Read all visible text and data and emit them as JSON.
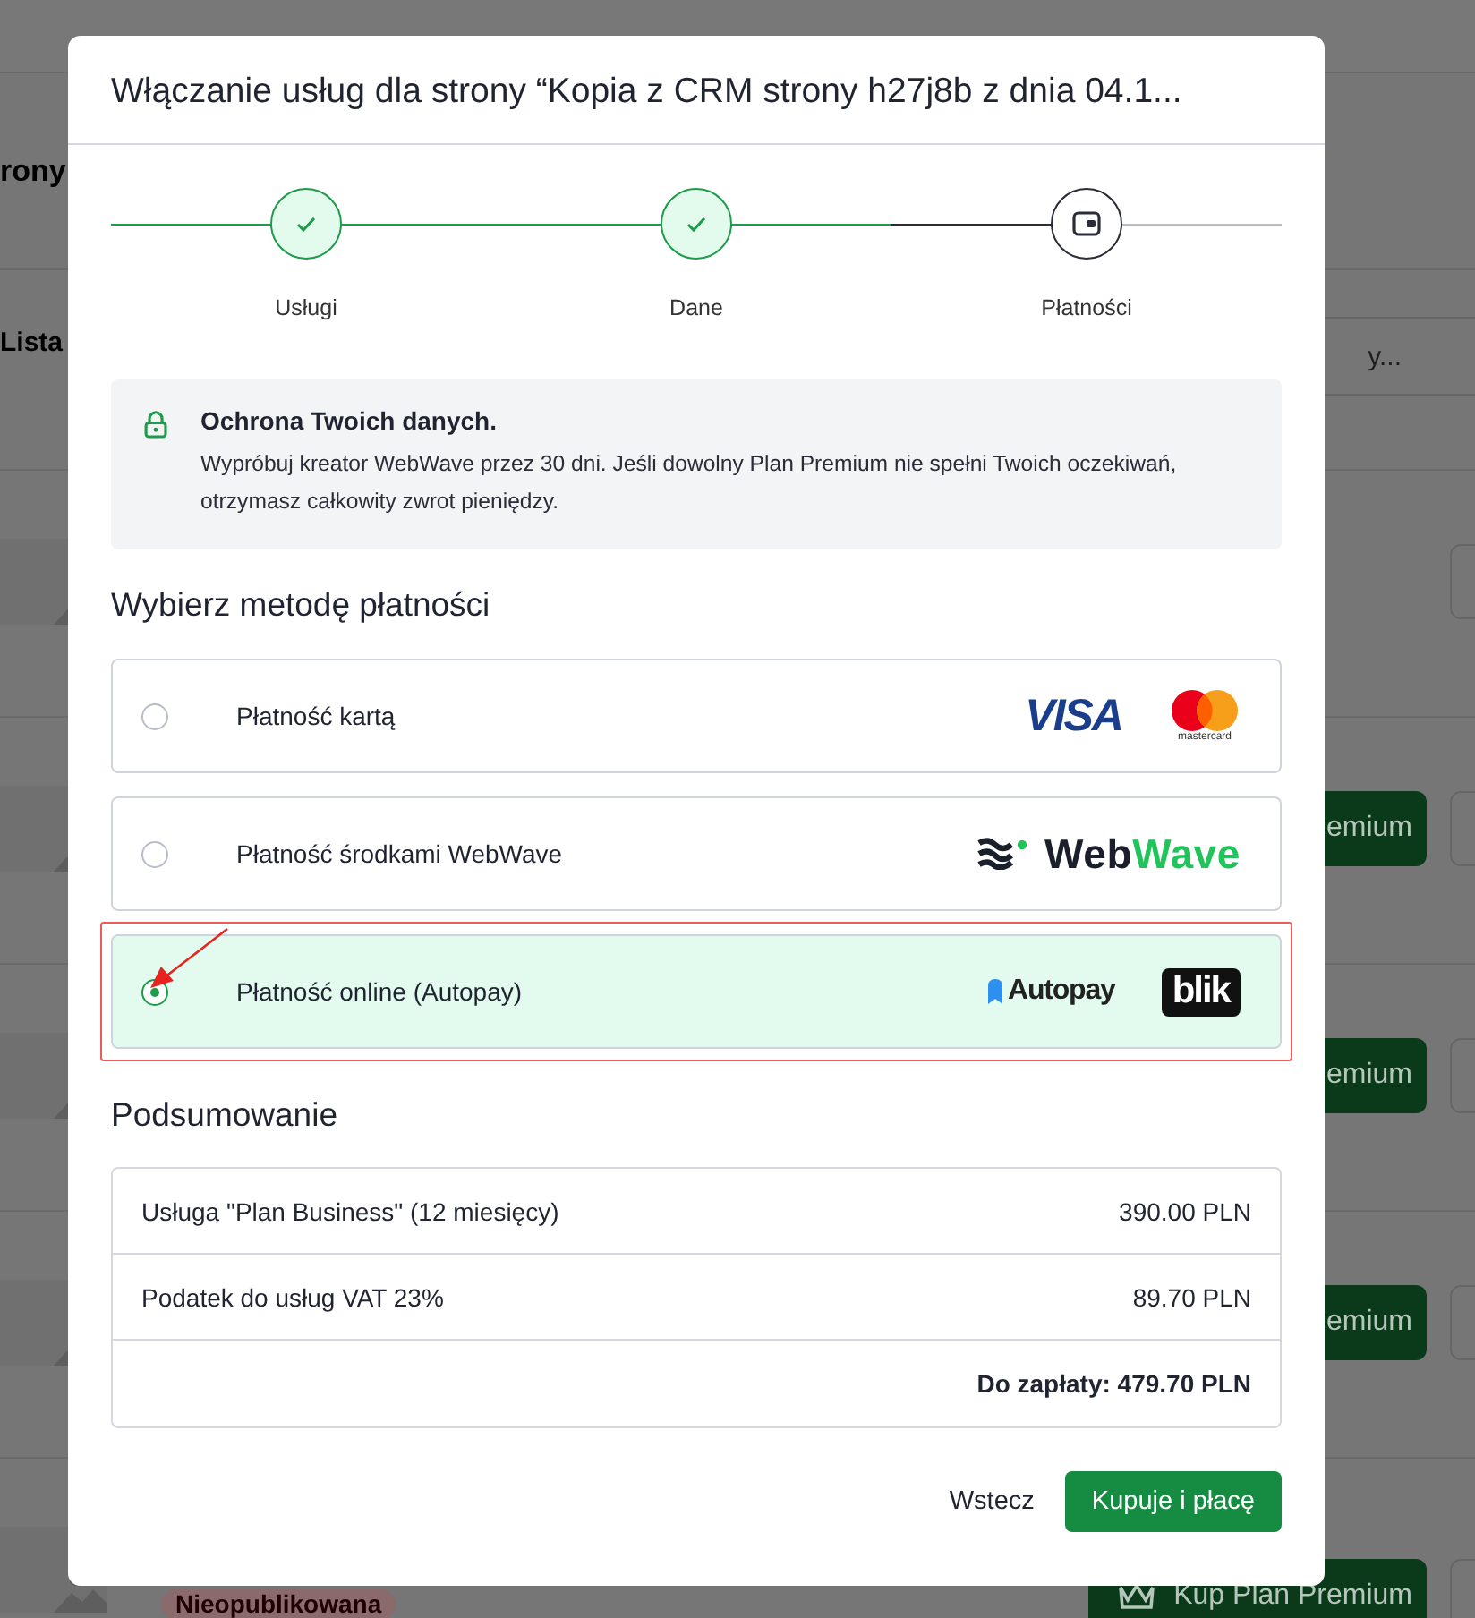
{
  "background": {
    "heading": "rony",
    "list_title": "Lista",
    "search": {
      "placeholder": "y..."
    },
    "rows": [
      {
        "kind": "plain"
      },
      {
        "kind": "offer",
        "button": "emium"
      },
      {
        "kind": "offer",
        "button": "emium"
      },
      {
        "kind": "offer",
        "button": "emium"
      },
      {
        "kind": "offer",
        "button": "Kup Plan Premium",
        "badge": "Nieopublikowana"
      }
    ]
  },
  "dialog": {
    "title": "Włączanie usług dla strony “Kopia z CRM strony h27j8b z dnia 04.1...",
    "steps": [
      {
        "label": "Usługi",
        "completed": true
      },
      {
        "label": "Dane",
        "completed": true
      },
      {
        "label": "Płatności",
        "completed": false
      }
    ],
    "notice": {
      "title": "Ochrona Twoich danych.",
      "text": "Wypróbuj kreator WebWave przez 30 dni. Jeśli dowolny Plan Premium nie spełni Twoich oczekiwań, otrzymasz całkowity zwrot pieniędzy."
    },
    "payment_heading": "Wybierz metodę płatności",
    "payment_methods": [
      {
        "label": "Płatność kartą",
        "selected": false,
        "annotated": false,
        "logos": [
          {
            "kind": "visa",
            "text": "VISA"
          },
          {
            "kind": "mastercard",
            "text": "mastercard"
          }
        ]
      },
      {
        "label": "Płatność środkami WebWave",
        "selected": false,
        "annotated": false,
        "logos": [
          {
            "kind": "webwave",
            "text": "Web",
            "accent": "Wave"
          }
        ]
      },
      {
        "label": "Płatność online (Autopay)",
        "selected": true,
        "annotated": true,
        "logos": [
          {
            "kind": "autopay",
            "text": "Autopay"
          },
          {
            "kind": "blik",
            "text": "blik"
          }
        ]
      }
    ],
    "summary_heading": "Podsumowanie",
    "summary": [
      {
        "label": "Usługa \"Plan Business\" (12 miesięcy)",
        "value": "390.00 PLN"
      },
      {
        "label": "Podatek do usług VAT 23%",
        "value": "89.70 PLN"
      }
    ],
    "total": "Do zapłaty: 479.70 PLN",
    "back_button": "Wstecz",
    "submit_button": "Kupuje i płacę"
  }
}
